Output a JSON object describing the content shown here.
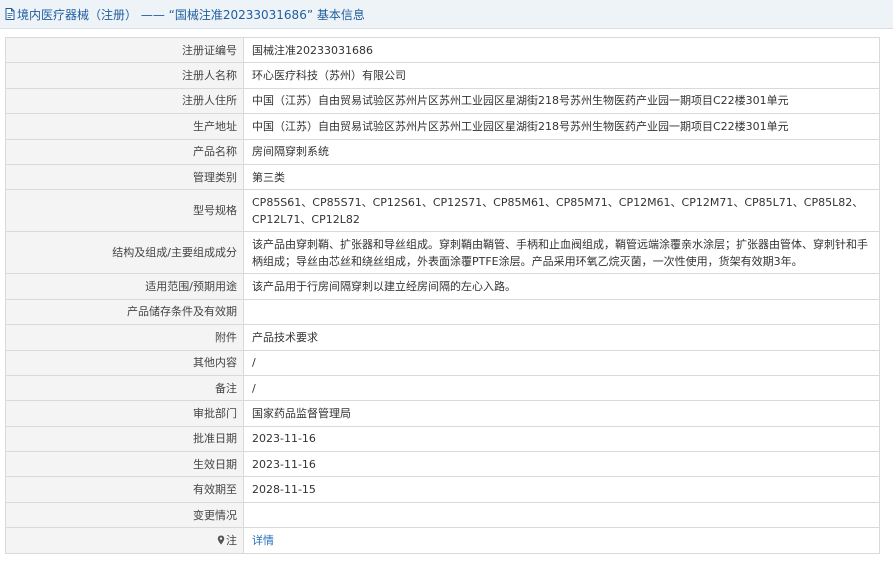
{
  "header": {
    "title": "境内医疗器械（注册） —— “国械注准20233031686” 基本信息",
    "icon": "document-icon"
  },
  "rows": [
    {
      "label": "注册证编号",
      "value": "国械注准20233031686"
    },
    {
      "label": "注册人名称",
      "value": "环心医疗科技（苏州）有限公司"
    },
    {
      "label": "注册人住所",
      "value": "中国（江苏）自由贸易试验区苏州片区苏州工业园区星湖街218号苏州生物医药产业园一期项目C22楼301单元"
    },
    {
      "label": "生产地址",
      "value": "中国（江苏）自由贸易试验区苏州片区苏州工业园区星湖街218号苏州生物医药产业园一期项目C22楼301单元"
    },
    {
      "label": "产品名称",
      "value": "房间隔穿刺系统"
    },
    {
      "label": "管理类别",
      "value": "第三类"
    },
    {
      "label": "型号规格",
      "value": "CP85S61、CP85S71、CP12S61、CP12S71、CP85M61、CP85M71、CP12M61、CP12M71、CP85L71、CP85L82、CP12L71、CP12L82"
    },
    {
      "label": "结构及组成/主要组成成分",
      "value": "该产品由穿刺鞘、扩张器和导丝组成。穿刺鞘由鞘管、手柄和止血阀组成，鞘管远端涂覆亲水涂层；扩张器由管体、穿刺针和手柄组成；导丝由芯丝和绕丝组成，外表面涂覆PTFE涂层。产品采用环氧乙烷灭菌，一次性使用，货架有效期3年。"
    },
    {
      "label": "适用范围/预期用途",
      "value": "该产品用于行房间隔穿刺以建立经房间隔的左心入路。"
    },
    {
      "label": "产品储存条件及有效期",
      "value": ""
    },
    {
      "label": "附件",
      "value": "产品技术要求"
    },
    {
      "label": "其他内容",
      "value": "/"
    },
    {
      "label": "备注",
      "value": "/"
    },
    {
      "label": "审批部门",
      "value": "国家药品监督管理局"
    },
    {
      "label": "批准日期",
      "value": "2023-11-16"
    },
    {
      "label": "生效日期",
      "value": "2023-11-16"
    },
    {
      "label": "有效期至",
      "value": "2028-11-15"
    },
    {
      "label": "变更情况",
      "value": ""
    }
  ],
  "note": {
    "label": "注",
    "icon": "location-pin-icon",
    "link_text": "详情"
  },
  "colors": {
    "header_bg": "#eef3f8",
    "title_color": "#1f5e9e",
    "label_bg": "#f4f4f4",
    "border": "#d9d9d9",
    "link": "#1f6fbf"
  }
}
